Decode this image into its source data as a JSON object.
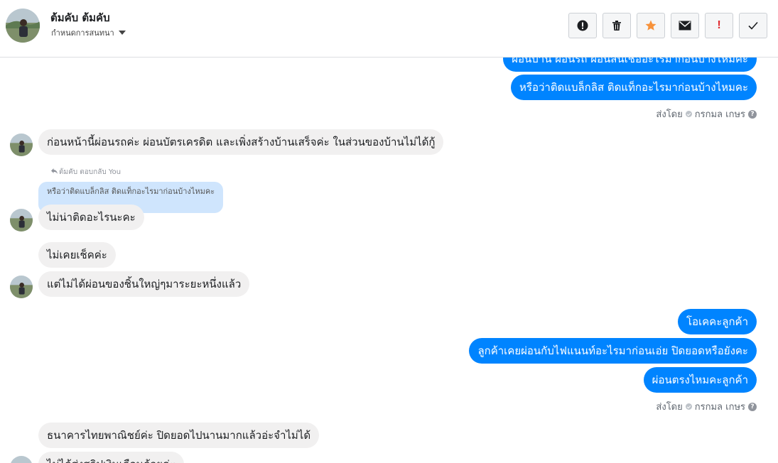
{
  "header": {
    "contact_name": "ต้มคับ ต้มคับ",
    "settings_label": "กำหนดการสนทนา"
  },
  "toolbar": {
    "icons": [
      "alert-circle-icon",
      "trash-icon",
      "star-icon",
      "envelope-icon",
      "exclamation-icon",
      "check-icon"
    ],
    "colors": {
      "star": "#f7923b",
      "exclamation": "#e0292e"
    },
    "exclamation_glyph": "!"
  },
  "colors": {
    "outgoing_bubble": "#0084ff",
    "incoming_bubble": "#f1f0f0",
    "quote_bubble": "#cfe5fd"
  },
  "thread": {
    "messages": [
      {
        "dir": "out",
        "text": "ผ่อนบ้าน ผ่อนรถ ผ่อนสินเชื่ออะไรมาก่อนบ้างไหมคะ"
      },
      {
        "dir": "out",
        "text": "หรือว่าติดแบล็กลิส ติดแท็กอะไรมาก่อนบ้างไหมคะ"
      },
      {
        "dir": "meta",
        "sent_by": "ส่งโดย",
        "sender": "กรกมล เกษร"
      },
      {
        "dir": "in",
        "text": "ก่อนหน้านี้ผ่อนรถค่ะ ผ่อนบัตรเครดิต และเพิ่งสร้างบ้านเสร็จค่ะ ในส่วนของบ้านไม่ได้กู้"
      },
      {
        "dir": "reply_note",
        "text": "ต้มคับ ตอบกลับ You"
      },
      {
        "dir": "quote",
        "text": "หรือว่าติดแบล็กลิส ติดแท็กอะไรมาก่อนบ้างไหมคะ"
      },
      {
        "dir": "in",
        "text": "ไม่น่าติดอะไรนะคะ"
      },
      {
        "dir": "in",
        "text": "ไม่เคยเช็คค่ะ"
      },
      {
        "dir": "in",
        "text": "แต่ไม่ได้ผ่อนของชิ้นใหญ่ๆมาระยะหนึ่งแล้ว"
      },
      {
        "dir": "out",
        "text": "โอเคคะลูกค้า"
      },
      {
        "dir": "out",
        "text": "ลูกค้าเคยผ่อนกับไฟแนนท์อะไรมาก่อนเอ่ย ปิดยอดหรือยังคะ"
      },
      {
        "dir": "out",
        "text": "ผ่อนตรงไหมคะลูกค้า"
      },
      {
        "dir": "meta",
        "sent_by": "ส่งโดย",
        "sender": "กรกมล เกษร"
      },
      {
        "dir": "in",
        "text": "ธนาคารไทยพาณิชย์ค่ะ ปิดยอดไปนานมากแล้วอ่ะจำไม่ได้"
      },
      {
        "dir": "in",
        "text": "ไม่ได้ส่งสลิปเงินเดือนด้วยค่ะ"
      }
    ]
  }
}
